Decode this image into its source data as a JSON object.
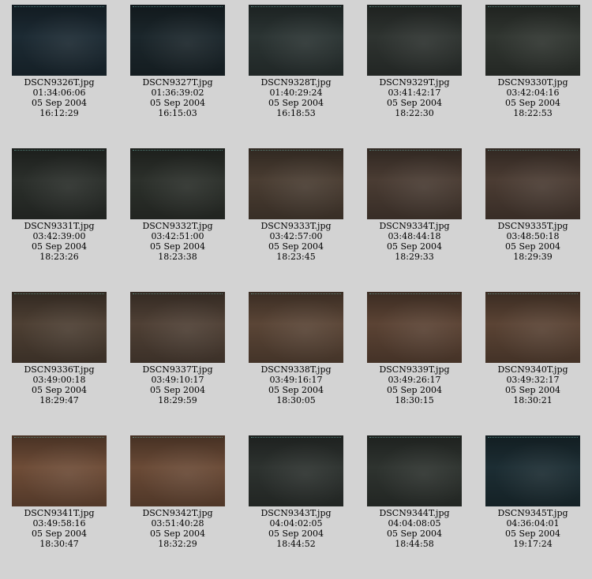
{
  "thumbnails": [
    {
      "file": "DSCN9326T.jpg",
      "timecode": "01:34:06:06",
      "date": "05 Sep 2004",
      "time": "16:12:29",
      "tone": "#1c2a33"
    },
    {
      "file": "DSCN9327T.jpg",
      "timecode": "01:36:39:02",
      "date": "05 Sep 2004",
      "time": "16:15:03",
      "tone": "#1b262b"
    },
    {
      "file": "DSCN9328T.jpg",
      "timecode": "01:40:29:24",
      "date": "05 Sep 2004",
      "time": "16:18:53",
      "tone": "#2b3433"
    },
    {
      "file": "DSCN9329T.jpg",
      "timecode": "03:41:42:17",
      "date": "05 Sep 2004",
      "time": "18:22:30",
      "tone": "#2e3330"
    },
    {
      "file": "DSCN9330T.jpg",
      "timecode": "03:42:04:16",
      "date": "05 Sep 2004",
      "time": "18:22:53",
      "tone": "#303530"
    },
    {
      "file": "DSCN9331T.jpg",
      "timecode": "03:42:39:00",
      "date": "05 Sep 2004",
      "time": "18:23:26",
      "tone": "#2b2f2b"
    },
    {
      "file": "DSCN9332T.jpg",
      "timecode": "03:42:51:00",
      "date": "05 Sep 2004",
      "time": "18:23:38",
      "tone": "#2c302b"
    },
    {
      "file": "DSCN9333T.jpg",
      "timecode": "03:42:57:00",
      "date": "05 Sep 2004",
      "time": "18:23:45",
      "tone": "#4a3d32"
    },
    {
      "file": "DSCN9334T.jpg",
      "timecode": "03:48:44:18",
      "date": "05 Sep 2004",
      "time": "18:29:33",
      "tone": "#4a3c33"
    },
    {
      "file": "DSCN9335T.jpg",
      "timecode": "03:48:50:18",
      "date": "05 Sep 2004",
      "time": "18:29:39",
      "tone": "#4b3c33"
    },
    {
      "file": "DSCN9336T.jpg",
      "timecode": "03:49:00:18",
      "date": "05 Sep 2004",
      "time": "18:29:47",
      "tone": "#4d3f33"
    },
    {
      "file": "DSCN9337T.jpg",
      "timecode": "03:49:10:17",
      "date": "05 Sep 2004",
      "time": "18:29:59",
      "tone": "#4f4035"
    },
    {
      "file": "DSCN9338T.jpg",
      "timecode": "03:49:16:17",
      "date": "05 Sep 2004",
      "time": "18:30:05",
      "tone": "#5a4536"
    },
    {
      "file": "DSCN9339T.jpg",
      "timecode": "03:49:26:17",
      "date": "05 Sep 2004",
      "time": "18:30:15",
      "tone": "#5b4334"
    },
    {
      "file": "DSCN9340T.jpg",
      "timecode": "03:49:32:17",
      "date": "05 Sep 2004",
      "time": "18:30:21",
      "tone": "#5a4334"
    },
    {
      "file": "DSCN9341T.jpg",
      "timecode": "03:49:58:16",
      "date": "05 Sep 2004",
      "time": "18:30:47",
      "tone": "#6e4c37"
    },
    {
      "file": "DSCN9342T.jpg",
      "timecode": "03:51:40:28",
      "date": "05 Sep 2004",
      "time": "18:32:29",
      "tone": "#6a4a36"
    },
    {
      "file": "DSCN9343T.jpg",
      "timecode": "04:04:02:05",
      "date": "05 Sep 2004",
      "time": "18:44:52",
      "tone": "#2d322f"
    },
    {
      "file": "DSCN9344T.jpg",
      "timecode": "04:04:08:05",
      "date": "05 Sep 2004",
      "time": "18:44:58",
      "tone": "#2e332f"
    },
    {
      "file": "DSCN9345T.jpg",
      "timecode": "04:36:04:01",
      "date": "05 Sep 2004",
      "time": "19:17:24",
      "tone": "#1c2d33"
    }
  ]
}
